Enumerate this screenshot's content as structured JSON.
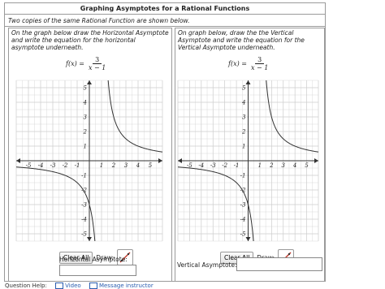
{
  "title": "Graphing Asymptotes for a Rational Functions",
  "subtitle": "Two copies of the same Rational Function are shown below.",
  "left": {
    "instructions": "On the graph below draw the Horizontal Asymptote and write the equation for the horizontal asymptote underneath.",
    "clear_label": "Clear All",
    "draw_label": "Draw:",
    "asymptote_label": "Horizontal Asymptote:",
    "asymptote_value": ""
  },
  "right": {
    "instructions": "On graph below, draw the the Vertical Asymptote and write the equation for the Vertical Asymptote underneath.",
    "clear_label": "Clear All",
    "draw_label": "Draw:",
    "asymptote_label": "Vertical Asymptote:",
    "asymptote_value": ""
  },
  "function": {
    "lhs": "f(x) =",
    "numerator": "3",
    "denominator": "x − 1"
  },
  "graph": {
    "x_ticks": [
      "-5",
      "-4",
      "-3",
      "-2",
      "-1",
      "1",
      "2",
      "3",
      "4",
      "5"
    ],
    "y_ticks": [
      "5",
      "4",
      "3",
      "2",
      "1",
      "-1",
      "-2",
      "-3",
      "-4",
      "-5"
    ],
    "curve_color": "#333333",
    "grid_color": "#cccccc"
  },
  "footer": {
    "help_label": "Question Help:",
    "video_label": "Video",
    "message_label": "Message instructor"
  },
  "colors": {
    "border": "#9a9a9a",
    "link": "#2a5db0"
  }
}
